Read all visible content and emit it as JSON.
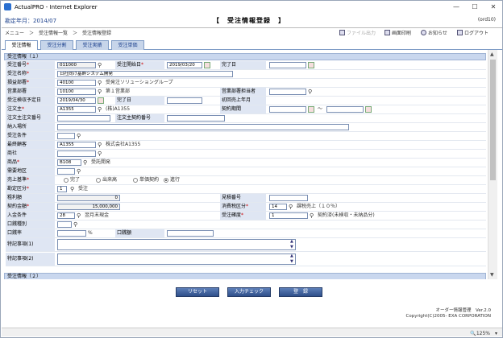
{
  "window": {
    "title": "ActualPRO - Internet Explorer",
    "minimize": "—",
    "maximize": "☐",
    "close": "✕"
  },
  "header": {
    "year_month": "勘定年月：2014/07",
    "page_title": "【　受注情報登録　】",
    "page_id": "(ord10)"
  },
  "breadcrumb": {
    "text": "メニュー　＞　受注情報一覧　＞　受注情報登録"
  },
  "toolbar": {
    "file_output": "ファイル出力",
    "print": "画面印刷",
    "notice": "お知らせ",
    "logout": "ログアウト"
  },
  "tabs": [
    "受注情報",
    "受注分割",
    "受注実績",
    "受注単価"
  ],
  "sections": {
    "first": "受注情報（１）",
    "second": "受注情報（２）"
  },
  "form": {
    "order_no_label": "受注番号",
    "order_no": "011000",
    "start_date_label": "受注開始日",
    "start_date": "2019/03/20",
    "end_date_label": "完了日",
    "order_name_label": "受注名称",
    "order_name": "日社向け基幹システム開発",
    "dept_label": "損益部署",
    "dept_code": "40100",
    "dept_name": "受発注ソリューショングループ",
    "sales_dept_label": "営業部署",
    "sales_dept_code": "10100",
    "sales_dept_name": "第１営業部",
    "sales_person_label": "営業部署担当者",
    "plan_date_label": "受注検収予定日",
    "plan_date": "2019/04/30",
    "done_date_label": "完了日",
    "first_month_label": "初回売上年月",
    "customer_label": "注文主",
    "customer_code": "A1355",
    "customer_name": "(株)A1355",
    "period_label": "契約期間",
    "period_sep": "～",
    "customer_order_label": "注文主注文番号",
    "customer_contract_label": "注文主契約番号",
    "delivery_label": "納入場所",
    "terms_label": "受注条件",
    "end_customer_label": "最終顧客",
    "end_customer_code": "A1355",
    "end_customer_name": "株式会社A1355",
    "trader_label": "商社",
    "product_label": "商品",
    "product_code": "B108",
    "product_name": "受託開発",
    "region_label": "需要地区",
    "revenue_label": "売上基準",
    "revenue_options": [
      "完了",
      "出来高",
      "単価契約",
      "進行"
    ],
    "account_label": "勘定区分",
    "account_code": "1",
    "account_name": "受注",
    "gross_label": "粗利額",
    "gross_value": "0",
    "estimate_label": "見積番号",
    "contract_amount_label": "契約金額",
    "contract_amount": "15,000,000",
    "tax_label": "消費税区分",
    "tax_code": "14",
    "tax_name": "課税売上（１０％）",
    "payment_label": "入金条件",
    "payment_code": "28",
    "payment_name": "翌月末現金",
    "certainty_label": "受注確度",
    "certainty_code": "1",
    "certainty_name": "契約済(未検収・未納品分)",
    "contract_type_label": "口銭種別",
    "commission_rate_label": "口銭率",
    "percent": "%",
    "commission_amount_label": "口銭額",
    "note1_label": "特記事項(1)",
    "note2_label": "特記事項(2)"
  },
  "buttons": {
    "reset": "リセット",
    "check": "入力チェック",
    "register": "登　録"
  },
  "footer": {
    "line1": "オーダー情報管理　Ver.2.0",
    "line2": "Copyright(C)2005- EXA CORPORATION"
  },
  "status": {
    "zoom": "🔍125%　▾"
  }
}
